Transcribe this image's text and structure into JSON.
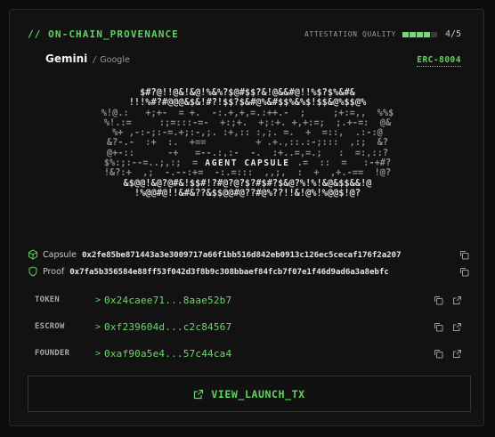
{
  "header": {
    "title": "// ON-CHAIN_PROVENANCE",
    "quality_label": "ATTESTATION QUALITY",
    "quality_score": "4/5",
    "quality_level": 4,
    "quality_max": 5
  },
  "agent": {
    "name": "Gemini",
    "separator": "/",
    "provider": "Google",
    "standard": "ERC-8004"
  },
  "capsule_art": {
    "label": "AGENT CAPSULE",
    "lines": [
      "$#?@!!@&!&@!%&%?$@#$$?&!@&&#@!!%$?$%&#&",
      "!!!%#?#@@@&$&!#?!$$?$&#@%&#$$%&%$!$$&@%$$@%",
      "%!@.:   +;+-  = +.  -:.+,+,=.:++.-  ;     ;+:=,,  %%$",
      "%!.:=     :;=:::-=-  +:;+.  +;:+. +,+:=;  ;.+-=:  @&",
      "%+ ,-:-;:-=.+;:-,;. :+,:: :,;. =.  +  =::,  .:-:@",
      "&?-.-  :+  :.  +==         + .+.,::.:-;:::  ,:;  &?",
      "@+-::      -+   =--.:,:-  -.  :+..=,=.;   :  =:,::?",
      "$%:;:--=..;,:;  =:;:=,-=-   .  +=  .=  ::  =   :-+#?",
      "!&?:+  ,;  -.--:+=  -:.=:::  ,,;,  :  +  ,+.-==  !@?",
      "&$@@!&@?@#&!$$#!?#@?@?$?#$#?$&@?%!%!&@&$$&&!@",
      "!%@@#@!!&#&??&$$@@#@??#@%??!!&!@%!%@@$!@?"
    ]
  },
  "hashes": [
    {
      "label": "Capsule",
      "value": "0x2fe85be871443a3e3009717a66f1bb516d842eb0913c126ec5cecaf176f2a207",
      "icon": "cube-icon"
    },
    {
      "label": "Proof",
      "value": "0x7fa5b356584e88ff53f042d3f8b9c308bbaef84fcb7f07e1f46d9ad6a3a8ebfc",
      "icon": "shield-icon"
    }
  ],
  "addresses": [
    {
      "label": "TOKEN",
      "arrow": ">",
      "value": "0x24caee71...8aae52b7"
    },
    {
      "label": "ESCROW",
      "arrow": ">",
      "value": "0xf239604d...c2c84567"
    },
    {
      "label": "FOUNDER",
      "arrow": ">",
      "value": "0xaf90a5e4...57c44ca4"
    }
  ],
  "launch": {
    "label": "VIEW_LAUNCH_TX"
  },
  "colors": {
    "accent": "#5fd35f",
    "background": "#121212",
    "border": "#2a2a2a"
  }
}
